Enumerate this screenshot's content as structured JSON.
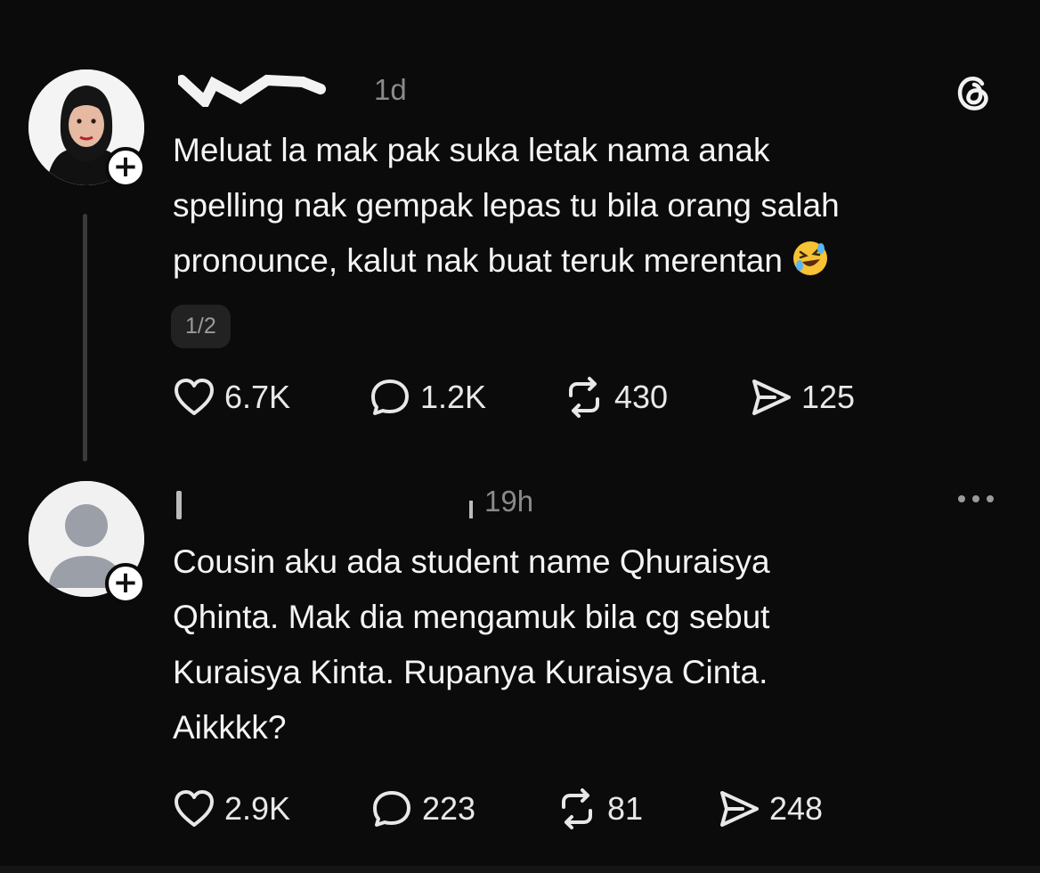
{
  "posts": [
    {
      "username": "",
      "time": "1d",
      "lines": [
        "Meluat la mak pak suka letak nama anak",
        "spelling nak gempak lepas tu bila orang salah",
        "pronounce, kalut nak buat teruk merentan"
      ],
      "emoji": "rolling-on-floor-laughing",
      "page_indicator": "1/2",
      "likes": "6.7K",
      "replies": "1.2K",
      "reposts": "430",
      "shares": "125"
    },
    {
      "username": "",
      "time": "19h",
      "lines": [
        "Cousin aku ada student name Qhuraisya",
        "Qhinta. Mak dia mengamuk bila cg sebut",
        "Kuraisya Kinta. Rupanya Kuraisya Cinta.",
        "Aikkkk?"
      ],
      "likes": "2.9K",
      "replies": "223",
      "reposts": "81",
      "shares": "248"
    }
  ],
  "icons": {
    "brand": "threads-logo-icon",
    "more": "more-options-icon",
    "like": "heart-icon",
    "reply": "comment-icon",
    "repost": "repost-icon",
    "share": "share-icon",
    "follow": "plus-icon"
  },
  "colors": {
    "background": "#0b0b0b",
    "text": "#f4f4f4",
    "muted": "#8a8a8a"
  }
}
